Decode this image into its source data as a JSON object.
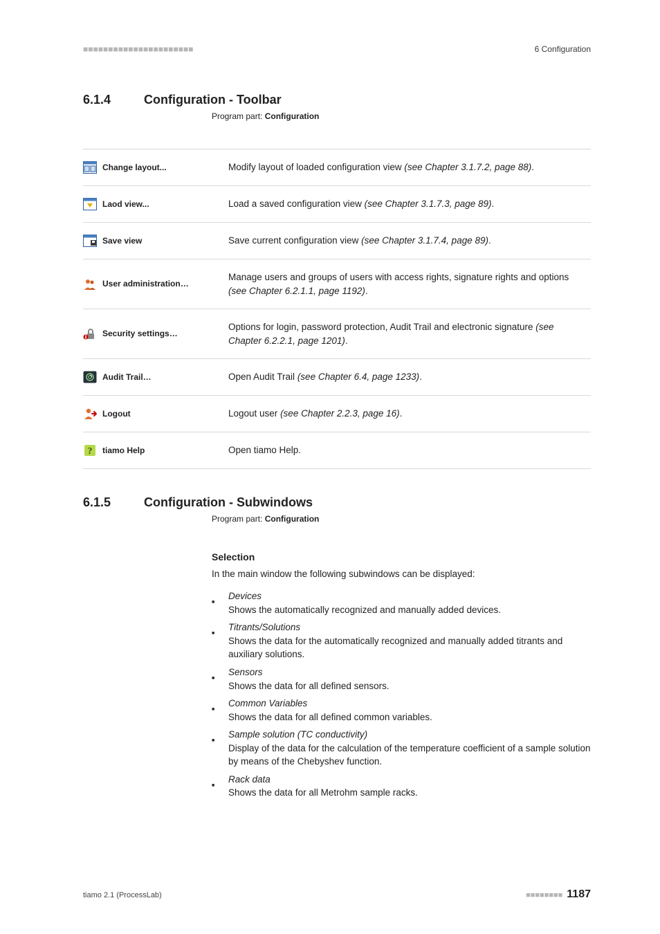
{
  "header": {
    "dashes": "■■■■■■■■■■■■■■■■■■■■■■",
    "chapter_label": "6 Configuration"
  },
  "section_toolbar": {
    "number": "6.1.4",
    "title": "Configuration - Toolbar",
    "program_part_prefix": "Program part: ",
    "program_part_value": "Configuration"
  },
  "toolbar_rows": [
    {
      "icon": "layout",
      "label": "Change layout...",
      "desc": "Modify layout of loaded configuration view ",
      "ref": "(see Chapter 3.1.7.2, page 88)",
      "tail": "."
    },
    {
      "icon": "load",
      "label": "Laod view...",
      "desc": "Load a saved configuration view ",
      "ref": "(see Chapter 3.1.7.3, page 89)",
      "tail": "."
    },
    {
      "icon": "save",
      "label": "Save view",
      "desc": "Save current configuration view ",
      "ref": "(see Chapter 3.1.7.4, page 89)",
      "tail": "."
    },
    {
      "icon": "users",
      "label": "User administration…",
      "desc": "Manage users and groups of users with access rights, signature rights and options ",
      "ref": "(see Chapter 6.2.1.1, page 1192)",
      "tail": "."
    },
    {
      "icon": "security",
      "label": "Security settings…",
      "desc": "Options for login, password protection, Audit Trail and electronic signature ",
      "ref": "(see Chapter 6.2.2.1, page 1201)",
      "tail": "."
    },
    {
      "icon": "audit",
      "label": "Audit Trail…",
      "desc": "Open Audit Trail ",
      "ref": "(see Chapter 6.4, page 1233)",
      "tail": "."
    },
    {
      "icon": "logout",
      "label": "Logout",
      "desc": "Logout user ",
      "ref": "(see Chapter 2.2.3, page 16)",
      "tail": "."
    },
    {
      "icon": "help",
      "label": "tiamo Help",
      "desc": "Open tiamo Help.",
      "ref": "",
      "tail": ""
    }
  ],
  "section_subwindows": {
    "number": "6.1.5",
    "title": "Configuration - Subwindows",
    "program_part_prefix": "Program part: ",
    "program_part_value": "Configuration",
    "selection_heading": "Selection",
    "selection_intro": "In the main window the following subwindows can be displayed:"
  },
  "subwindow_items": [
    {
      "term": "Devices",
      "def": "Shows the automatically recognized and manually added devices."
    },
    {
      "term": "Titrants/Solutions",
      "def": "Shows the data for the automatically recognized and manually added titrants and auxiliary solutions."
    },
    {
      "term": "Sensors",
      "def": "Shows the data for all defined sensors."
    },
    {
      "term": "Common Variables",
      "def": "Shows the data for all defined common variables."
    },
    {
      "term": "Sample solution (TC conductivity)",
      "def": "Display of the data for the calculation of the temperature coefficient of a sample solution by means of the Chebyshev function."
    },
    {
      "term": "Rack data",
      "def": "Shows the data for all Metrohm sample racks."
    }
  ],
  "footer": {
    "left": "tiamo 2.1 (ProcessLab)",
    "dashes": "■■■■■■■■",
    "page": "1187"
  }
}
